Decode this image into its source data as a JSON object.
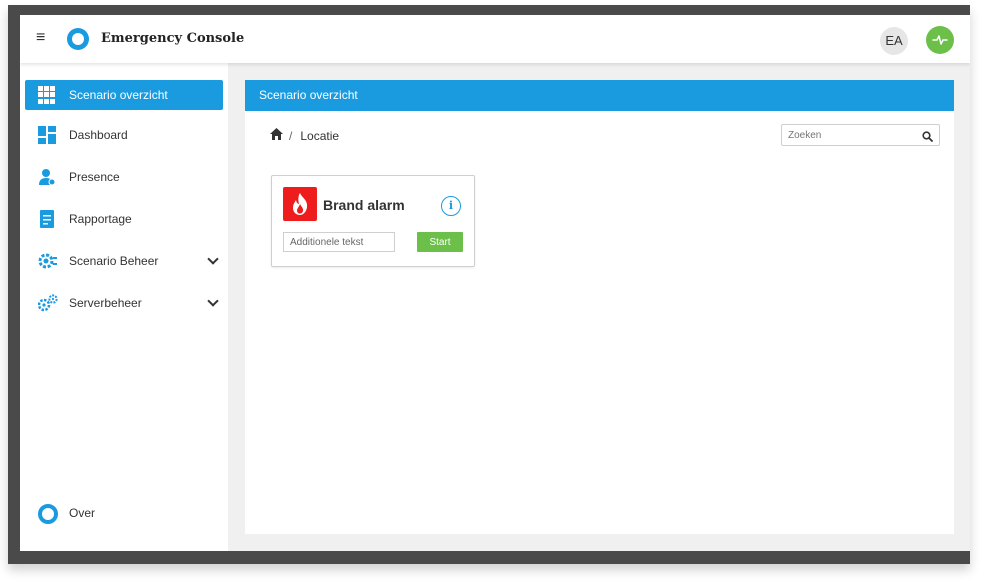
{
  "app": {
    "title": "Emergency Console",
    "user_initials": "EA"
  },
  "icons": {
    "menu": "hamburger-icon",
    "logo": "logo-ring-icon",
    "health": "heartbeat-icon",
    "home": "home-icon",
    "search": "search-icon",
    "alarm": "fire-icon",
    "info": "info-icon"
  },
  "colors": {
    "accent": "#1a9be0",
    "success": "#6cc04a",
    "danger": "#ee1c1c"
  },
  "sidebar": {
    "items": [
      {
        "label": "Scenario overzicht",
        "icon": "grid-icon",
        "active": true
      },
      {
        "label": "Dashboard",
        "icon": "dashboard-icon"
      },
      {
        "label": "Presence",
        "icon": "user-icon"
      },
      {
        "label": "Rapportage",
        "icon": "report-icon"
      },
      {
        "label": "Scenario Beheer",
        "icon": "scenario-gear-icon",
        "expandable": true
      },
      {
        "label": "Serverbeheer",
        "icon": "server-gears-icon",
        "expandable": true
      }
    ],
    "footer": {
      "label": "Over",
      "icon": "logo-ring-icon"
    }
  },
  "main": {
    "header": "Scenario overzicht",
    "breadcrumb": {
      "separator": "/",
      "current": "Locatie"
    },
    "search": {
      "placeholder": "Zoeken",
      "value": ""
    },
    "cards": [
      {
        "title": "Brand alarm",
        "info": "i",
        "input_placeholder": "Additionele tekst",
        "button": "Start"
      }
    ]
  }
}
